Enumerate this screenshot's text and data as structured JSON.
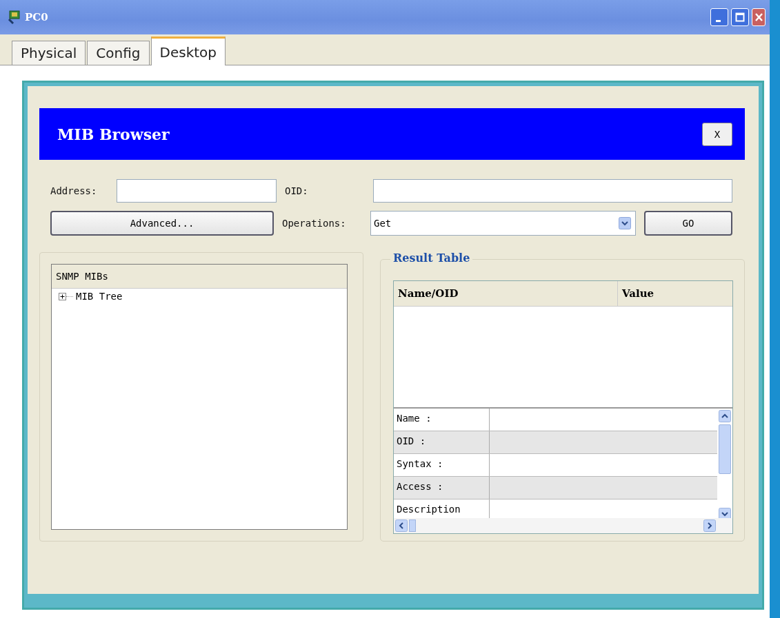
{
  "window": {
    "title": "PC0"
  },
  "tabs": [
    {
      "label": "Physical",
      "selected": false
    },
    {
      "label": "Config",
      "selected": false
    },
    {
      "label": "Desktop",
      "selected": true
    }
  ],
  "app": {
    "title": "MIB Browser",
    "close_label": "X",
    "address_label": "Address:",
    "oid_label": "OID:",
    "advanced_button": "Advanced...",
    "operations_label": "Operations:",
    "operation": "Get",
    "go_button": "GO",
    "tree": {
      "header": "SNMP MIBs",
      "items": [
        {
          "label": "MIB Tree",
          "expanded": false
        }
      ]
    },
    "result": {
      "title": "Result Table",
      "columns": [
        "Name/OID",
        "Value"
      ],
      "details": [
        {
          "label": "Name :"
        },
        {
          "label": "OID :"
        },
        {
          "label": "Syntax :"
        },
        {
          "label": "Access :"
        },
        {
          "label": "Description"
        }
      ]
    }
  }
}
